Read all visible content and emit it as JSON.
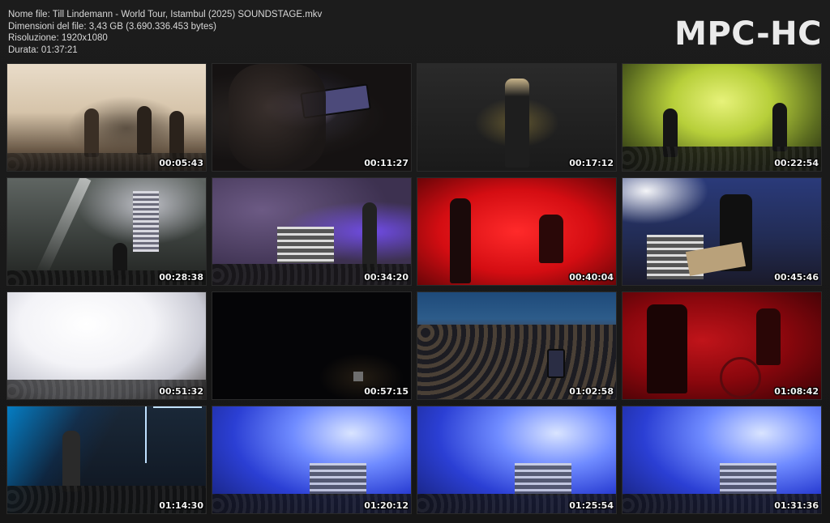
{
  "header": {
    "file_name": "Nome file: Till Lindemann - World Tour, Istambul (2025) SOUNDSTAGE.mkv",
    "file_size": "Dimensioni del file: 3,43 GB (3.690.336.453 bytes)",
    "resolution": "Risoluzione: 1920x1080",
    "duration": "Durata: 01:37:21"
  },
  "brand": "MPC-HC",
  "thumbnails": [
    {
      "timestamp": "00:05:43"
    },
    {
      "timestamp": "00:11:27"
    },
    {
      "timestamp": "00:17:12"
    },
    {
      "timestamp": "00:22:54"
    },
    {
      "timestamp": "00:28:38"
    },
    {
      "timestamp": "00:34:20"
    },
    {
      "timestamp": "00:40:04"
    },
    {
      "timestamp": "00:45:46"
    },
    {
      "timestamp": "00:51:32"
    },
    {
      "timestamp": "00:57:15"
    },
    {
      "timestamp": "01:02:58"
    },
    {
      "timestamp": "01:08:42"
    },
    {
      "timestamp": "01:14:30"
    },
    {
      "timestamp": "01:20:12"
    },
    {
      "timestamp": "01:25:54"
    },
    {
      "timestamp": "01:31:36"
    }
  ]
}
